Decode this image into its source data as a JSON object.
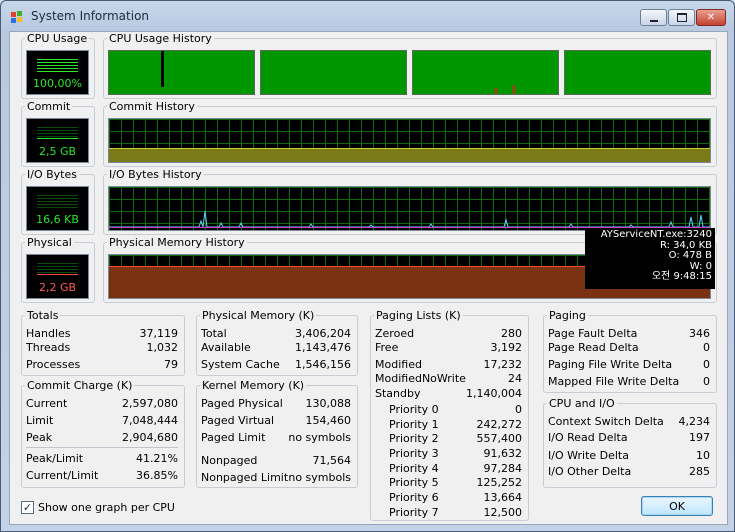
{
  "window": {
    "title": "System Information",
    "min_icon": "minimize-icon",
    "max_icon": "maximize-icon",
    "close_icon": "close-icon"
  },
  "graphs": {
    "cpu_usage": {
      "label": "CPU Usage",
      "value": "100,00%",
      "level": 1.0
    },
    "cpu_history": {
      "label": "CPU Usage History"
    },
    "commit": {
      "label": "Commit",
      "value": "2,5 GB"
    },
    "commit_history": {
      "label": "Commit History"
    },
    "io": {
      "label": "I/O Bytes",
      "value": "16,6  KB"
    },
    "io_history": {
      "label": "I/O Bytes History"
    },
    "physical": {
      "label": "Physical",
      "value": "2,2 GB"
    },
    "physical_history": {
      "label": "Physical Memory History"
    }
  },
  "tooltip": {
    "line1": "AYServiceNT.exe:3240",
    "line2": "R: 34,0  KB",
    "line3": "O: 478 B",
    "line4": "W: 0",
    "line5": "오전 9:48:15"
  },
  "totals": {
    "label": "Totals",
    "rows": [
      {
        "k": "Handles",
        "v": "37,119"
      },
      {
        "k": "Threads",
        "v": "1,032"
      },
      {
        "k": "Processes",
        "v": "79"
      }
    ]
  },
  "commit_charge": {
    "label": "Commit Charge (K)",
    "rows": [
      {
        "k": "Current",
        "v": "2,597,080"
      },
      {
        "k": "Limit",
        "v": "7,048,444"
      },
      {
        "k": "Peak",
        "v": "2,904,680"
      },
      {
        "k": "Peak/Limit",
        "v": "41.21%"
      },
      {
        "k": "Current/Limit",
        "v": "36.85%"
      }
    ]
  },
  "physical_memory": {
    "label": "Physical Memory (K)",
    "rows": [
      {
        "k": "Total",
        "v": "3,406,204"
      },
      {
        "k": "Available",
        "v": "1,143,476"
      },
      {
        "k": "System Cache",
        "v": "1,546,156"
      }
    ]
  },
  "kernel_memory": {
    "label": "Kernel Memory (K)",
    "rows": [
      {
        "k": "Paged Physical",
        "v": "130,088"
      },
      {
        "k": "Paged Virtual",
        "v": "154,460"
      },
      {
        "k": "Paged Limit",
        "v": "no symbols"
      },
      {
        "k": "Nonpaged",
        "v": "71,564"
      },
      {
        "k": "Nonpaged Limit",
        "v": "no symbols"
      }
    ]
  },
  "paging_lists": {
    "label": "Paging Lists (K)",
    "rows": [
      {
        "k": "Zeroed",
        "v": "280"
      },
      {
        "k": "Free",
        "v": "3,192"
      },
      {
        "k": "Modified",
        "v": "17,232"
      },
      {
        "k": "ModifiedNoWrite",
        "v": "24"
      },
      {
        "k": "Standby",
        "v": "1,140,004"
      },
      {
        "k": "Priority 0",
        "v": "0"
      },
      {
        "k": "Priority 1",
        "v": "242,272"
      },
      {
        "k": "Priority 2",
        "v": "557,400"
      },
      {
        "k": "Priority 3",
        "v": "91,632"
      },
      {
        "k": "Priority 4",
        "v": "97,284"
      },
      {
        "k": "Priority 5",
        "v": "125,252"
      },
      {
        "k": "Priority 6",
        "v": "13,664"
      },
      {
        "k": "Priority 7",
        "v": "12,500"
      }
    ]
  },
  "paging": {
    "label": "Paging",
    "rows": [
      {
        "k": "Page Fault Delta",
        "v": "346"
      },
      {
        "k": "Page Read Delta",
        "v": "0"
      },
      {
        "k": "Paging File Write Delta",
        "v": "0"
      },
      {
        "k": "Mapped File Write Delta",
        "v": "0"
      }
    ]
  },
  "cpu_io": {
    "label": "CPU and I/O",
    "rows": [
      {
        "k": "Context Switch Delta",
        "v": "4,234"
      },
      {
        "k": "I/O Read Delta",
        "v": "197"
      },
      {
        "k": "I/O Write Delta",
        "v": "10"
      },
      {
        "k": "I/O Other Delta",
        "v": "285"
      }
    ]
  },
  "footer": {
    "checkbox_label": "Show one graph per CPU",
    "checkbox_checked": true,
    "ok_label": "OK"
  },
  "colors": {
    "graph_bg": "#000000",
    "grid": "#0c6a0c",
    "cpu_green": "#009600",
    "meter_text": "#29e829",
    "physical_red": "#ff5a5a"
  }
}
